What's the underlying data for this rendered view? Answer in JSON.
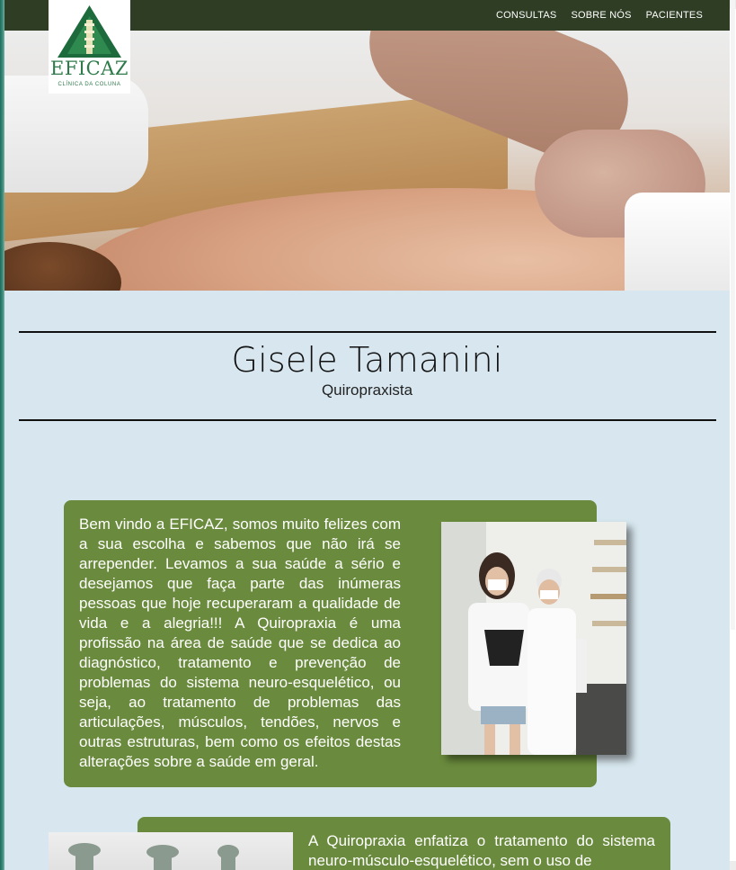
{
  "logo": {
    "brand": "EFICAZ",
    "tagline": "CLÍNICA DA COLUNA"
  },
  "nav": {
    "items": [
      "CONSULTAS",
      "SOBRE NÓS",
      "PACIENTES"
    ]
  },
  "hero": {
    "image": "massage-back-photo"
  },
  "profile": {
    "name": "Gisele Tamanini",
    "role": "Quiropraxista"
  },
  "intro": {
    "text": "Bem vindo a EFICAZ, somos muito felizes com a sua escolha e sabemos que não irá se arrepender. Levamos a sua saúde a sério e desejamos que faça parte das inúmeras pessoas que hoje recuperaram a qualidade de vida e a alegria!!! A Quiropraxia é uma profissão na área de saúde que se dedica ao diagnóstico, tratamento e prevenção de problemas do sistema neuro-esquelético, ou seja, ao tratamento de problemas das articulações, músculos, tendões, nervos e outras estruturas, bem como os efeitos destas alterações sobre a saúde em geral.",
    "photo": "clinic-staff-photo"
  },
  "second": {
    "text": "A Quiropraxia enfatiza o tratamento do sistema neuro-músculo-esquelético, sem o uso de",
    "photo": "vertebrae-model-photo"
  },
  "colors": {
    "topbar": "#2f3d25",
    "card": "#6a8b3d",
    "page": "#d8e7ef",
    "logo_green": "#2e7a4a"
  }
}
